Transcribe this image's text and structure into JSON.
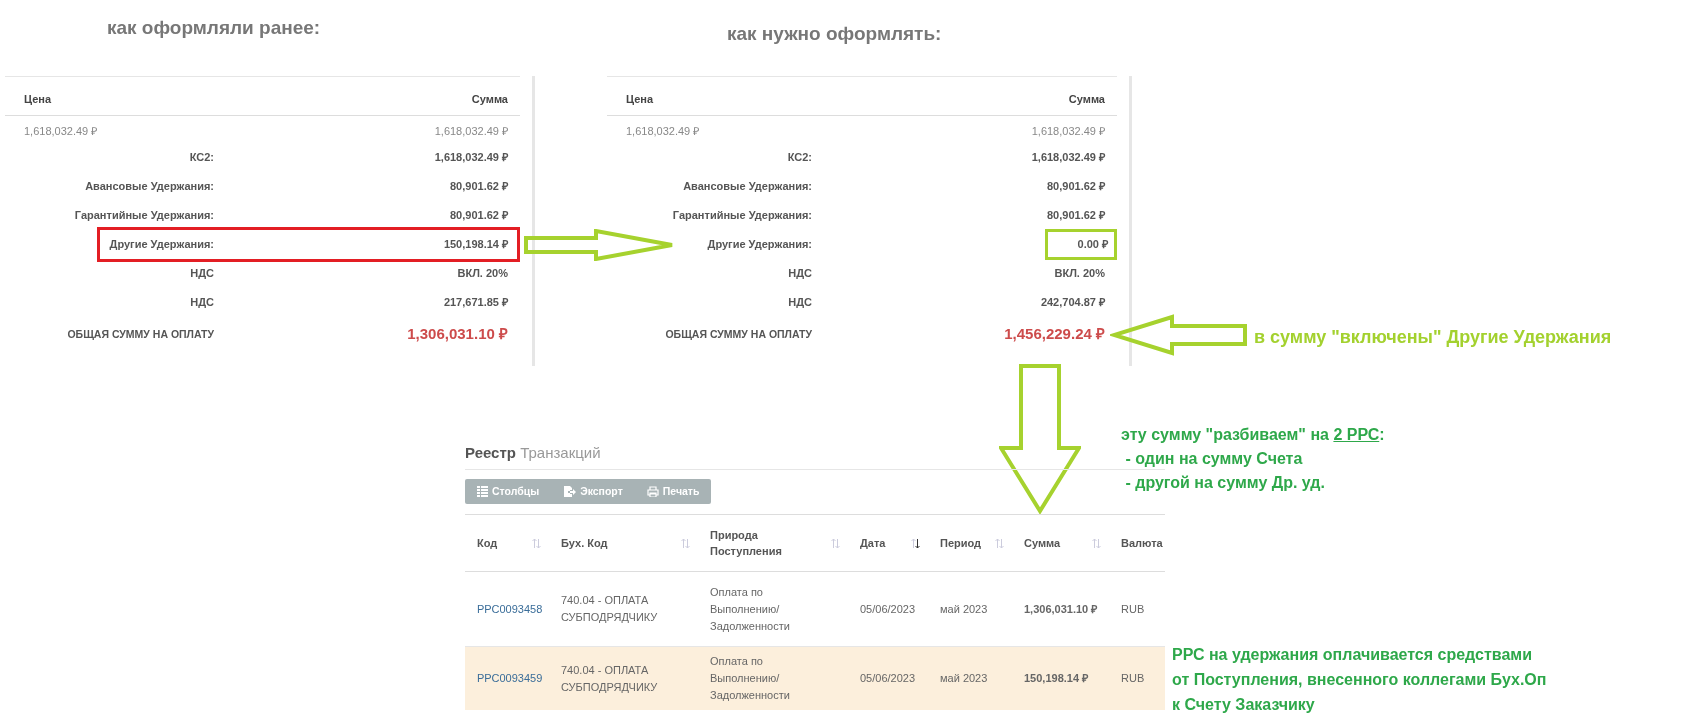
{
  "panels": [
    {
      "heading": "как оформляли ранее:",
      "columns": [
        "Цена",
        "Сумма"
      ],
      "price_row": [
        "1,618,032.49 ₽",
        "1,618,032.49 ₽"
      ],
      "summary": [
        {
          "kind": "plain",
          "label": "КС2:",
          "value": "1,618,032.49 ₽"
        },
        {
          "kind": "plain",
          "label": "Авансовые Удержания:",
          "value": "80,901.62 ₽"
        },
        {
          "kind": "plain",
          "label": "Гарантийные Удержания:",
          "value": "80,901.62 ₽"
        },
        {
          "kind": "framed_row",
          "color": "#e31e24",
          "label": "Другие Удержания:",
          "value": "150,198.14 ₽"
        },
        {
          "kind": "plain",
          "label": "НДС",
          "value": "ВКЛ. 20%"
        },
        {
          "kind": "plain",
          "label": "НДС",
          "value": "217,671.85 ₽"
        }
      ],
      "total": {
        "label": "ОБЩАЯ СУММУ НА ОПЛАТУ",
        "value": "1,306,031.10 ₽"
      }
    },
    {
      "heading": "как нужно оформлять:",
      "columns": [
        "Цена",
        "Сумма"
      ],
      "price_row": [
        "1,618,032.49 ₽",
        "1,618,032.49 ₽"
      ],
      "summary": [
        {
          "kind": "plain",
          "label": "КС2:",
          "value": "1,618,032.49 ₽"
        },
        {
          "kind": "plain",
          "label": "Авансовые Удержания:",
          "value": "80,901.62 ₽"
        },
        {
          "kind": "plain",
          "label": "Гарантийные Удержания:",
          "value": "80,901.62 ₽"
        },
        {
          "kind": "framed_value",
          "color": "#a6d22e",
          "label": "Другие Удержания:",
          "value": "0.00 ₽"
        },
        {
          "kind": "plain",
          "label": "НДС",
          "value": "ВКЛ. 20%"
        },
        {
          "kind": "plain",
          "label": "НДС",
          "value": "242,704.87 ₽"
        }
      ],
      "total": {
        "label": "ОБЩАЯ СУММУ НА ОПЛАТУ",
        "value": "1,456,229.24 ₽"
      }
    }
  ],
  "notes": {
    "included": "в сумму \"включены\" Другие Удержания",
    "split": {
      "before": "эту сумму \"разбиваем\" на ",
      "underlined": "2 РРС",
      "after": ":",
      "lines": [
        " - один на сумму Счета",
        " - другой на сумму Др. уд."
      ]
    },
    "funding": [
      "РРС на удержания оплачивается средствами",
      "от Поступления, внесенного коллегами Бух.Оп",
      "к Счету Заказчику"
    ]
  },
  "register": {
    "title": "Реестр",
    "subtitle": "Транзакций",
    "toolbar": [
      "Столбцы",
      "Экспорт",
      "Печать"
    ],
    "columns": [
      {
        "label": "Код",
        "sortable": true,
        "sorted": false
      },
      {
        "label": "Бух. Код",
        "sortable": true,
        "sorted": false
      },
      {
        "label": "Природа Поступления",
        "sortable": true,
        "sorted": false
      },
      {
        "label": "Дата",
        "sortable": true,
        "sorted": true
      },
      {
        "label": "Период",
        "sortable": true,
        "sorted": false
      },
      {
        "label": "Сумма",
        "sortable": true,
        "sorted": false
      },
      {
        "label": "Валюта",
        "sortable": false
      }
    ],
    "rows": [
      {
        "highlighted": false,
        "cells": [
          "РРС0093458",
          "740.04 - ОПЛАТА СУБПОДРЯДЧИКУ",
          "Оплата по Выполнению/ Задолженности",
          "05/06/2023",
          "май 2023",
          "1,306,031.10 ₽",
          "RUB"
        ]
      },
      {
        "highlighted": true,
        "cells": [
          "РРС0093459",
          "740.04 - ОПЛАТА СУБПОДРЯДЧИКУ",
          "Оплата по Выполнению/ Задолженности",
          "05/06/2023",
          "май 2023",
          "150,198.14 ₽",
          "RUB"
        ]
      }
    ]
  }
}
